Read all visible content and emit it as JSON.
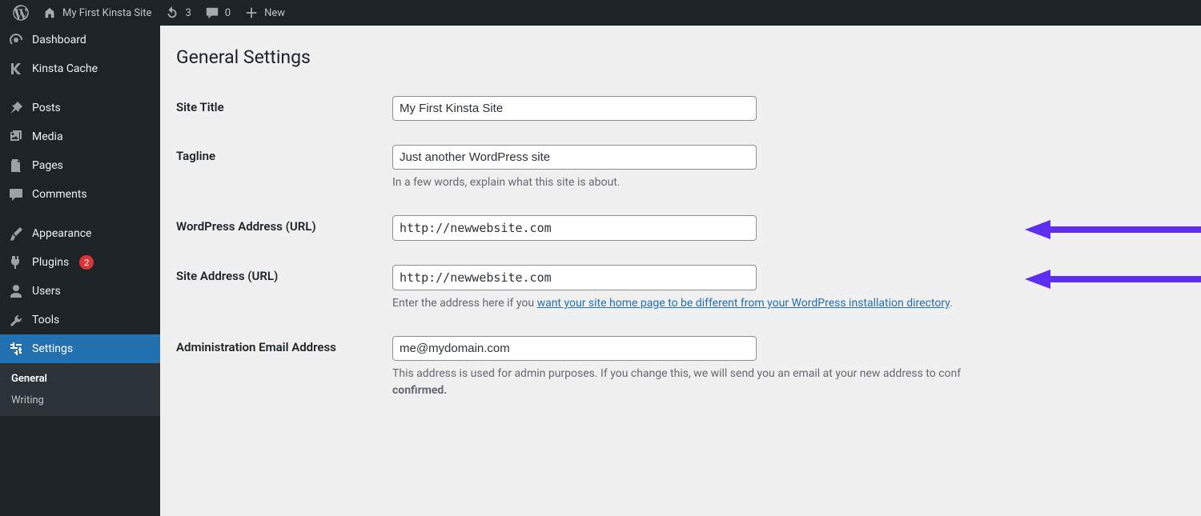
{
  "admin_bar": {
    "site_title": "My First Kinsta Site",
    "updates_count": "3",
    "comments_count": "0",
    "new_label": "New"
  },
  "sidebar": {
    "dashboard": "Dashboard",
    "kinsta_cache": "Kinsta Cache",
    "posts": "Posts",
    "media": "Media",
    "pages": "Pages",
    "comments": "Comments",
    "appearance": "Appearance",
    "plugins": "Plugins",
    "plugins_badge": "2",
    "users": "Users",
    "tools": "Tools",
    "settings": "Settings",
    "submenu": {
      "general": "General",
      "writing": "Writing"
    }
  },
  "page": {
    "title": "General Settings"
  },
  "fields": {
    "site_title": {
      "label": "Site Title",
      "value": "My First Kinsta Site"
    },
    "tagline": {
      "label": "Tagline",
      "value": "Just another WordPress site",
      "help": "In a few words, explain what this site is about."
    },
    "wp_url": {
      "label": "WordPress Address (URL)",
      "value": "http://newwebsite.com"
    },
    "site_url": {
      "label": "Site Address (URL)",
      "value": "http://newwebsite.com",
      "help_prefix": "Enter the address here if you ",
      "help_link": "want your site home page to be different from your WordPress installation directory",
      "help_suffix": "."
    },
    "admin_email": {
      "label": "Administration Email Address",
      "value": "me@mydomain.com",
      "help_line1": "This address is used for admin purposes. If you change this, we will send you an email at your new address to conf",
      "help_bold": "confirmed."
    }
  }
}
